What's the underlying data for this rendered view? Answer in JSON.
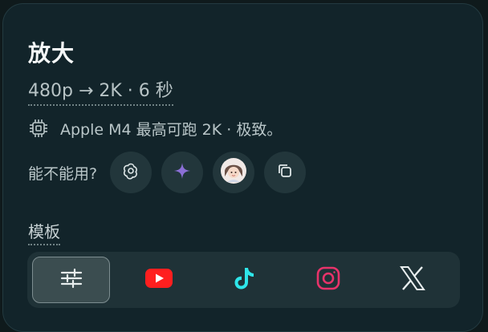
{
  "header": {
    "title": "放大",
    "subtitle": "480p → 2K · 6 秒"
  },
  "hardware": {
    "icon": "chip-icon",
    "text": "Apple M4 最高可跑 2K · 极致。"
  },
  "availability": {
    "label": "能不能用?",
    "buttons": [
      "openai-icon",
      "sparkle-icon",
      "avatar-icon",
      "copy-icon"
    ]
  },
  "templates": {
    "label": "模板",
    "tabs": [
      {
        "icon": "sliders-icon",
        "active": true
      },
      {
        "icon": "youtube-icon",
        "active": false
      },
      {
        "icon": "tiktok-icon",
        "active": false
      },
      {
        "icon": "instagram-icon",
        "active": false
      },
      {
        "icon": "x-icon",
        "active": false
      }
    ]
  },
  "colors": {
    "background": "#0f1a1c",
    "card": "#12242a",
    "youtube": "#ff1f1f",
    "tiktok": "#2ee6ea",
    "instagram": "#e8336a",
    "sparkle": "#8b6fd6"
  }
}
